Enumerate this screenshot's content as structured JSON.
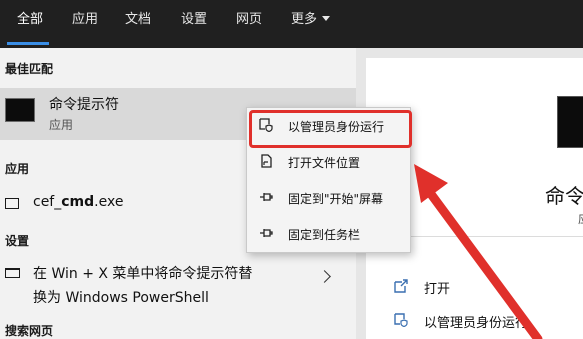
{
  "tabs": [
    {
      "label": "全部",
      "active": true
    },
    {
      "label": "应用"
    },
    {
      "label": "文档"
    },
    {
      "label": "设置"
    },
    {
      "label": "网页"
    },
    {
      "label": "更多"
    }
  ],
  "best_match": {
    "header": "最佳匹配",
    "title": "命令提示符",
    "subtitle": "应用"
  },
  "apps": {
    "header": "应用",
    "item_pre": "cef_",
    "item_bold": "cmd",
    "item_post": ".exe"
  },
  "settings": {
    "header": "设置",
    "line1": "在 Win + X 菜单中将命令提示符替",
    "line2": "换为 Windows PowerShell"
  },
  "web": {
    "header": "搜索网页"
  },
  "context_menu": {
    "items": [
      {
        "label": "以管理员身份运行",
        "icon": "shield-icon",
        "highlighted": true
      },
      {
        "label": "打开文件位置",
        "icon": "file-location-icon"
      },
      {
        "label": "固定到\"开始\"屏幕",
        "icon": "pin-icon"
      },
      {
        "label": "固定到任务栏",
        "icon": "pin-icon"
      }
    ]
  },
  "details": {
    "title": "命令提",
    "subtitle": "应",
    "actions": [
      {
        "label": "打开",
        "icon": "open-icon"
      },
      {
        "label": "以管理员身份运行",
        "icon": "shield-icon"
      }
    ]
  },
  "colors": {
    "topbar": "#202020",
    "accent": "#3a8ee6",
    "highlight_border": "#e0302b",
    "annotation_arrow": "#e0302b"
  }
}
